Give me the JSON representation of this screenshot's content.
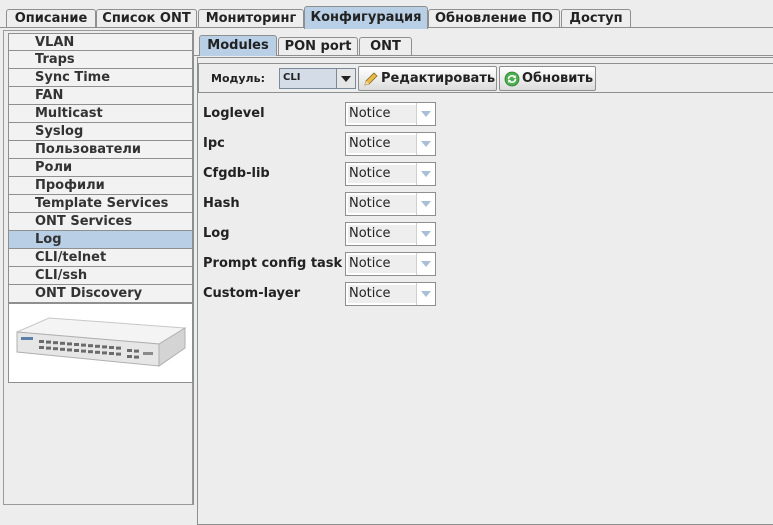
{
  "top_tabs": [
    {
      "label": "Описание",
      "active": false
    },
    {
      "label": "Список ONT",
      "active": false
    },
    {
      "label": "Мониторинг",
      "active": false
    },
    {
      "label": "Конфигурация",
      "active": true
    },
    {
      "label": "Обновление ПО",
      "active": false
    },
    {
      "label": "Доступ",
      "active": false
    }
  ],
  "sidebar": {
    "items": [
      {
        "label": "VLAN"
      },
      {
        "label": "Traps"
      },
      {
        "label": "Sync Time"
      },
      {
        "label": "FAN"
      },
      {
        "label": "Multicast"
      },
      {
        "label": "Syslog"
      },
      {
        "label": "Пользователи"
      },
      {
        "label": "Роли"
      },
      {
        "label": "Профили"
      },
      {
        "label": "Template Services"
      },
      {
        "label": "ONT Services"
      },
      {
        "label": "Log",
        "selected": true
      },
      {
        "label": "CLI/telnet"
      },
      {
        "label": "CLI/ssh"
      },
      {
        "label": "ONT Discovery"
      }
    ],
    "device_image": "olt-device-icon"
  },
  "sub_tabs": [
    {
      "label": "Modules",
      "active": true
    },
    {
      "label": "PON port",
      "active": false
    },
    {
      "label": "ONT",
      "active": false
    }
  ],
  "toolbar": {
    "module_label": "Модуль:",
    "module_value": "CLI",
    "edit_label": "Редактировать",
    "refresh_label": "Обновить"
  },
  "settings": [
    {
      "label": "Loglevel",
      "value": "Notice"
    },
    {
      "label": "Ipc",
      "value": "Notice"
    },
    {
      "label": "Cfgdb-lib",
      "value": "Notice"
    },
    {
      "label": "Hash",
      "value": "Notice"
    },
    {
      "label": "Log",
      "value": "Notice"
    },
    {
      "label": "Prompt config task",
      "value": "Notice"
    },
    {
      "label": "Custom-layer",
      "value": "Notice"
    }
  ],
  "colors": {
    "active_tab": "#b8cfe5",
    "background": "#ededed",
    "border": "#8e8f8f"
  }
}
